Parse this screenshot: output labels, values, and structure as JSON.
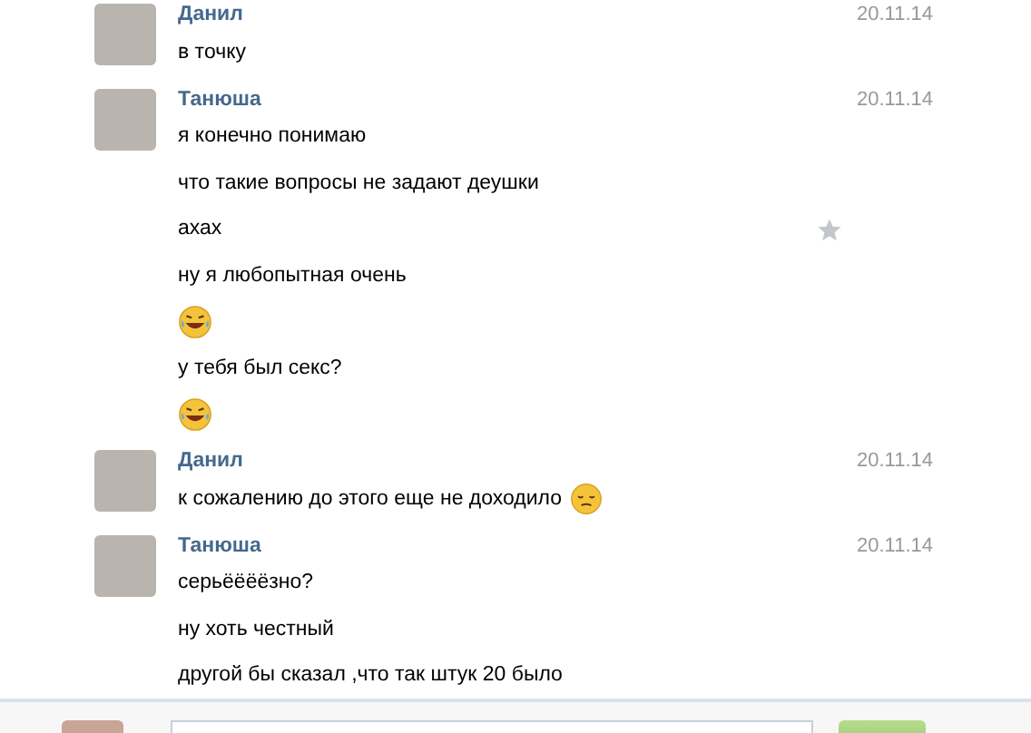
{
  "messages": [
    {
      "author": "Данил",
      "date": "20.11.14",
      "lines": [
        {
          "kind": "text",
          "text": "в точку",
          "starred": false
        }
      ]
    },
    {
      "author": "Танюша",
      "date": "20.11.14",
      "lines": [
        {
          "kind": "text",
          "text": "я конечно понимаю",
          "starred": false
        },
        {
          "kind": "text",
          "text": "что такие вопросы не задают деушки",
          "starred": false
        },
        {
          "kind": "text",
          "text": "ахах",
          "starred": true
        },
        {
          "kind": "text",
          "text": "ну я любопытная очень",
          "starred": false
        },
        {
          "kind": "laugh",
          "starred": false
        },
        {
          "kind": "text",
          "text": "у тебя был секс?",
          "starred": false
        },
        {
          "kind": "laugh",
          "starred": false
        }
      ]
    },
    {
      "author": "Данил",
      "date": "20.11.14",
      "lines": [
        {
          "kind": "textsad",
          "text": "к сожалению до этого еще не доходило",
          "starred": false
        }
      ]
    },
    {
      "author": "Танюша",
      "date": "20.11.14",
      "lines": [
        {
          "kind": "text",
          "text": "серьёёёёзно?",
          "starred": false
        },
        {
          "kind": "text",
          "text": "ну хоть честный",
          "starred": false
        },
        {
          "kind": "text",
          "text": "другой бы сказал ,что так штук 20 было",
          "starred": false
        }
      ]
    }
  ]
}
